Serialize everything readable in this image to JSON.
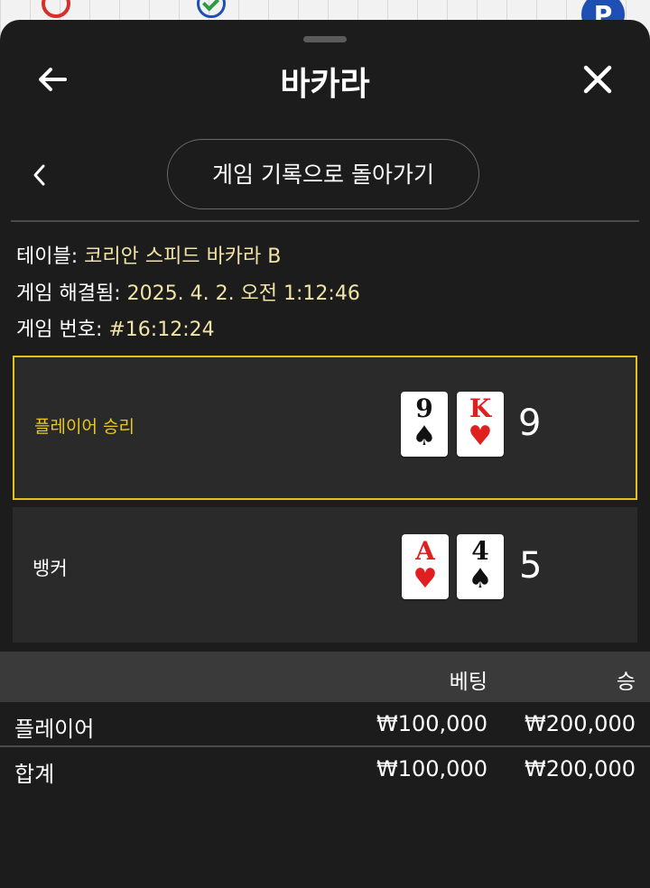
{
  "header": {
    "title": "바카라",
    "back_icon": "arrow-left-icon",
    "close_icon": "close-icon"
  },
  "nav": {
    "history_button_label": "게임 기록으로 돌아가기",
    "chevron_icon": "chevron-left-icon"
  },
  "info": {
    "table_label": "테이블:",
    "table_value": "코리안 스피드 바카라 B",
    "resolved_label": "게임 해결됨:",
    "resolved_value": "2025. 4. 2. 오전 1:12:46",
    "game_no_label": "게임 번호:",
    "game_no_value": "#16:12:24"
  },
  "result": {
    "player": {
      "label": "플레이어 승리",
      "cards": [
        {
          "rank": "9",
          "suit": "♠",
          "color": "black"
        },
        {
          "rank": "K",
          "suit": "♥",
          "color": "red"
        }
      ],
      "score": "9"
    },
    "banker": {
      "label": "뱅커",
      "cards": [
        {
          "rank": "A",
          "suit": "♥",
          "color": "red"
        },
        {
          "rank": "4",
          "suit": "♠",
          "color": "black"
        }
      ],
      "score": "5"
    }
  },
  "bets_table": {
    "headers": {
      "bet": "베팅",
      "win": "승"
    },
    "rows": [
      {
        "name": "플레이어",
        "bet": "₩100,000",
        "win": "₩200,000"
      }
    ],
    "total": {
      "name": "합계",
      "bet": "₩100,000",
      "win": "₩200,000"
    }
  },
  "colors": {
    "accent": "#e3c21d",
    "info_value": "#f1e4a6",
    "sheet_bg": "#1c1c1c",
    "row_bg": "#2a2a2a"
  }
}
